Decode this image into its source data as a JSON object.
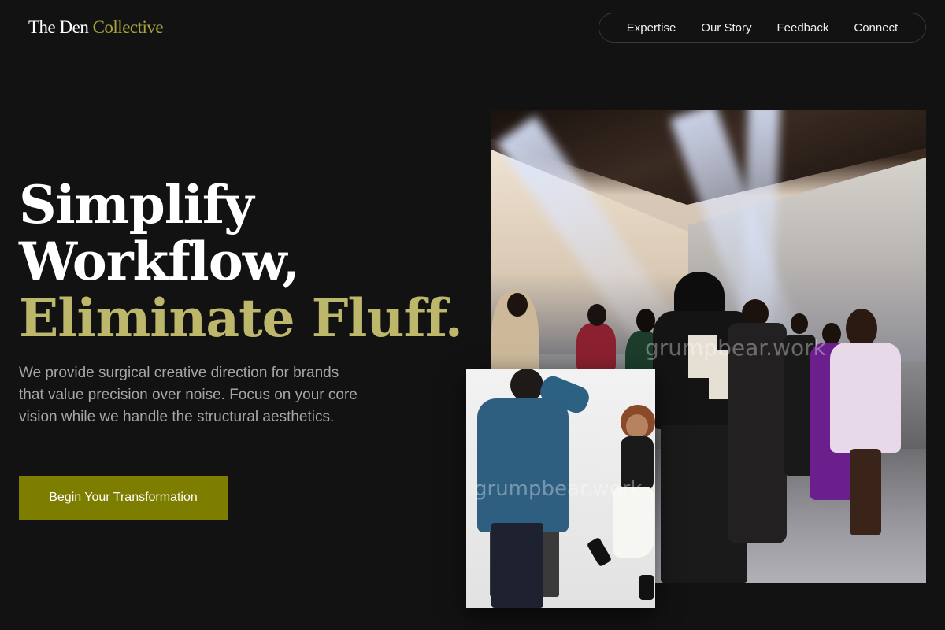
{
  "brand": {
    "name_part1": "The Den",
    "name_part2": "Collective"
  },
  "nav": {
    "items": [
      {
        "label": "Expertise"
      },
      {
        "label": "Our Story"
      },
      {
        "label": "Feedback"
      },
      {
        "label": "Connect"
      }
    ]
  },
  "hero": {
    "headline_line1": "Simplify",
    "headline_line2": "Workflow,",
    "headline_line3": "Eliminate Fluff.",
    "lead": "We provide surgical creative direction for brands that value precision over noise. Focus on your core vision while we handle the structural aesthetics.",
    "cta_label": "Begin Your Transformation"
  },
  "images": {
    "main_photo_watermark": "grumpbear.work",
    "small_photo_watermark": "grumpbear.work"
  },
  "colors": {
    "background": "#121212",
    "accent_olive": "#bdb76b",
    "cta_background": "#7d7d00",
    "muted_text": "#a6a6a6"
  }
}
